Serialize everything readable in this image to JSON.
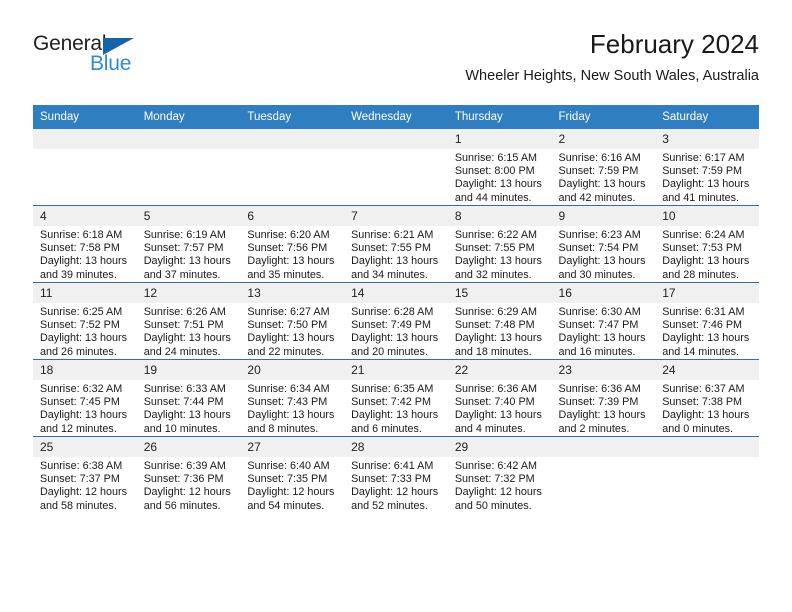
{
  "brand": {
    "general": "General",
    "blue": "Blue",
    "triangle_color": "#1464aa",
    "blue_color": "#2e8bd4"
  },
  "header": {
    "title": "February 2024",
    "subtitle": "Wheeler Heights, New South Wales, Australia"
  },
  "theme": {
    "header_bg": "#2f7ec1",
    "daynum_bg": "#f0f0f0",
    "row_rule": "#2f6fb0"
  },
  "weekday_headers": [
    "Sunday",
    "Monday",
    "Tuesday",
    "Wednesday",
    "Thursday",
    "Friday",
    "Saturday"
  ],
  "weeks": [
    [
      {
        "day": "",
        "sunrise": "",
        "sunset": "",
        "daylight1": "",
        "daylight2": ""
      },
      {
        "day": "",
        "sunrise": "",
        "sunset": "",
        "daylight1": "",
        "daylight2": ""
      },
      {
        "day": "",
        "sunrise": "",
        "sunset": "",
        "daylight1": "",
        "daylight2": ""
      },
      {
        "day": "",
        "sunrise": "",
        "sunset": "",
        "daylight1": "",
        "daylight2": ""
      },
      {
        "day": "1",
        "sunrise": "Sunrise: 6:15 AM",
        "sunset": "Sunset: 8:00 PM",
        "daylight1": "Daylight: 13 hours",
        "daylight2": "and 44 minutes."
      },
      {
        "day": "2",
        "sunrise": "Sunrise: 6:16 AM",
        "sunset": "Sunset: 7:59 PM",
        "daylight1": "Daylight: 13 hours",
        "daylight2": "and 42 minutes."
      },
      {
        "day": "3",
        "sunrise": "Sunrise: 6:17 AM",
        "sunset": "Sunset: 7:59 PM",
        "daylight1": "Daylight: 13 hours",
        "daylight2": "and 41 minutes."
      }
    ],
    [
      {
        "day": "4",
        "sunrise": "Sunrise: 6:18 AM",
        "sunset": "Sunset: 7:58 PM",
        "daylight1": "Daylight: 13 hours",
        "daylight2": "and 39 minutes."
      },
      {
        "day": "5",
        "sunrise": "Sunrise: 6:19 AM",
        "sunset": "Sunset: 7:57 PM",
        "daylight1": "Daylight: 13 hours",
        "daylight2": "and 37 minutes."
      },
      {
        "day": "6",
        "sunrise": "Sunrise: 6:20 AM",
        "sunset": "Sunset: 7:56 PM",
        "daylight1": "Daylight: 13 hours",
        "daylight2": "and 35 minutes."
      },
      {
        "day": "7",
        "sunrise": "Sunrise: 6:21 AM",
        "sunset": "Sunset: 7:55 PM",
        "daylight1": "Daylight: 13 hours",
        "daylight2": "and 34 minutes."
      },
      {
        "day": "8",
        "sunrise": "Sunrise: 6:22 AM",
        "sunset": "Sunset: 7:55 PM",
        "daylight1": "Daylight: 13 hours",
        "daylight2": "and 32 minutes."
      },
      {
        "day": "9",
        "sunrise": "Sunrise: 6:23 AM",
        "sunset": "Sunset: 7:54 PM",
        "daylight1": "Daylight: 13 hours",
        "daylight2": "and 30 minutes."
      },
      {
        "day": "10",
        "sunrise": "Sunrise: 6:24 AM",
        "sunset": "Sunset: 7:53 PM",
        "daylight1": "Daylight: 13 hours",
        "daylight2": "and 28 minutes."
      }
    ],
    [
      {
        "day": "11",
        "sunrise": "Sunrise: 6:25 AM",
        "sunset": "Sunset: 7:52 PM",
        "daylight1": "Daylight: 13 hours",
        "daylight2": "and 26 minutes."
      },
      {
        "day": "12",
        "sunrise": "Sunrise: 6:26 AM",
        "sunset": "Sunset: 7:51 PM",
        "daylight1": "Daylight: 13 hours",
        "daylight2": "and 24 minutes."
      },
      {
        "day": "13",
        "sunrise": "Sunrise: 6:27 AM",
        "sunset": "Sunset: 7:50 PM",
        "daylight1": "Daylight: 13 hours",
        "daylight2": "and 22 minutes."
      },
      {
        "day": "14",
        "sunrise": "Sunrise: 6:28 AM",
        "sunset": "Sunset: 7:49 PM",
        "daylight1": "Daylight: 13 hours",
        "daylight2": "and 20 minutes."
      },
      {
        "day": "15",
        "sunrise": "Sunrise: 6:29 AM",
        "sunset": "Sunset: 7:48 PM",
        "daylight1": "Daylight: 13 hours",
        "daylight2": "and 18 minutes."
      },
      {
        "day": "16",
        "sunrise": "Sunrise: 6:30 AM",
        "sunset": "Sunset: 7:47 PM",
        "daylight1": "Daylight: 13 hours",
        "daylight2": "and 16 minutes."
      },
      {
        "day": "17",
        "sunrise": "Sunrise: 6:31 AM",
        "sunset": "Sunset: 7:46 PM",
        "daylight1": "Daylight: 13 hours",
        "daylight2": "and 14 minutes."
      }
    ],
    [
      {
        "day": "18",
        "sunrise": "Sunrise: 6:32 AM",
        "sunset": "Sunset: 7:45 PM",
        "daylight1": "Daylight: 13 hours",
        "daylight2": "and 12 minutes."
      },
      {
        "day": "19",
        "sunrise": "Sunrise: 6:33 AM",
        "sunset": "Sunset: 7:44 PM",
        "daylight1": "Daylight: 13 hours",
        "daylight2": "and 10 minutes."
      },
      {
        "day": "20",
        "sunrise": "Sunrise: 6:34 AM",
        "sunset": "Sunset: 7:43 PM",
        "daylight1": "Daylight: 13 hours",
        "daylight2": "and 8 minutes."
      },
      {
        "day": "21",
        "sunrise": "Sunrise: 6:35 AM",
        "sunset": "Sunset: 7:42 PM",
        "daylight1": "Daylight: 13 hours",
        "daylight2": "and 6 minutes."
      },
      {
        "day": "22",
        "sunrise": "Sunrise: 6:36 AM",
        "sunset": "Sunset: 7:40 PM",
        "daylight1": "Daylight: 13 hours",
        "daylight2": "and 4 minutes."
      },
      {
        "day": "23",
        "sunrise": "Sunrise: 6:36 AM",
        "sunset": "Sunset: 7:39 PM",
        "daylight1": "Daylight: 13 hours",
        "daylight2": "and 2 minutes."
      },
      {
        "day": "24",
        "sunrise": "Sunrise: 6:37 AM",
        "sunset": "Sunset: 7:38 PM",
        "daylight1": "Daylight: 13 hours",
        "daylight2": "and 0 minutes."
      }
    ],
    [
      {
        "day": "25",
        "sunrise": "Sunrise: 6:38 AM",
        "sunset": "Sunset: 7:37 PM",
        "daylight1": "Daylight: 12 hours",
        "daylight2": "and 58 minutes."
      },
      {
        "day": "26",
        "sunrise": "Sunrise: 6:39 AM",
        "sunset": "Sunset: 7:36 PM",
        "daylight1": "Daylight: 12 hours",
        "daylight2": "and 56 minutes."
      },
      {
        "day": "27",
        "sunrise": "Sunrise: 6:40 AM",
        "sunset": "Sunset: 7:35 PM",
        "daylight1": "Daylight: 12 hours",
        "daylight2": "and 54 minutes."
      },
      {
        "day": "28",
        "sunrise": "Sunrise: 6:41 AM",
        "sunset": "Sunset: 7:33 PM",
        "daylight1": "Daylight: 12 hours",
        "daylight2": "and 52 minutes."
      },
      {
        "day": "29",
        "sunrise": "Sunrise: 6:42 AM",
        "sunset": "Sunset: 7:32 PM",
        "daylight1": "Daylight: 12 hours",
        "daylight2": "and 50 minutes."
      },
      {
        "day": "",
        "sunrise": "",
        "sunset": "",
        "daylight1": "",
        "daylight2": ""
      },
      {
        "day": "",
        "sunrise": "",
        "sunset": "",
        "daylight1": "",
        "daylight2": ""
      }
    ]
  ]
}
